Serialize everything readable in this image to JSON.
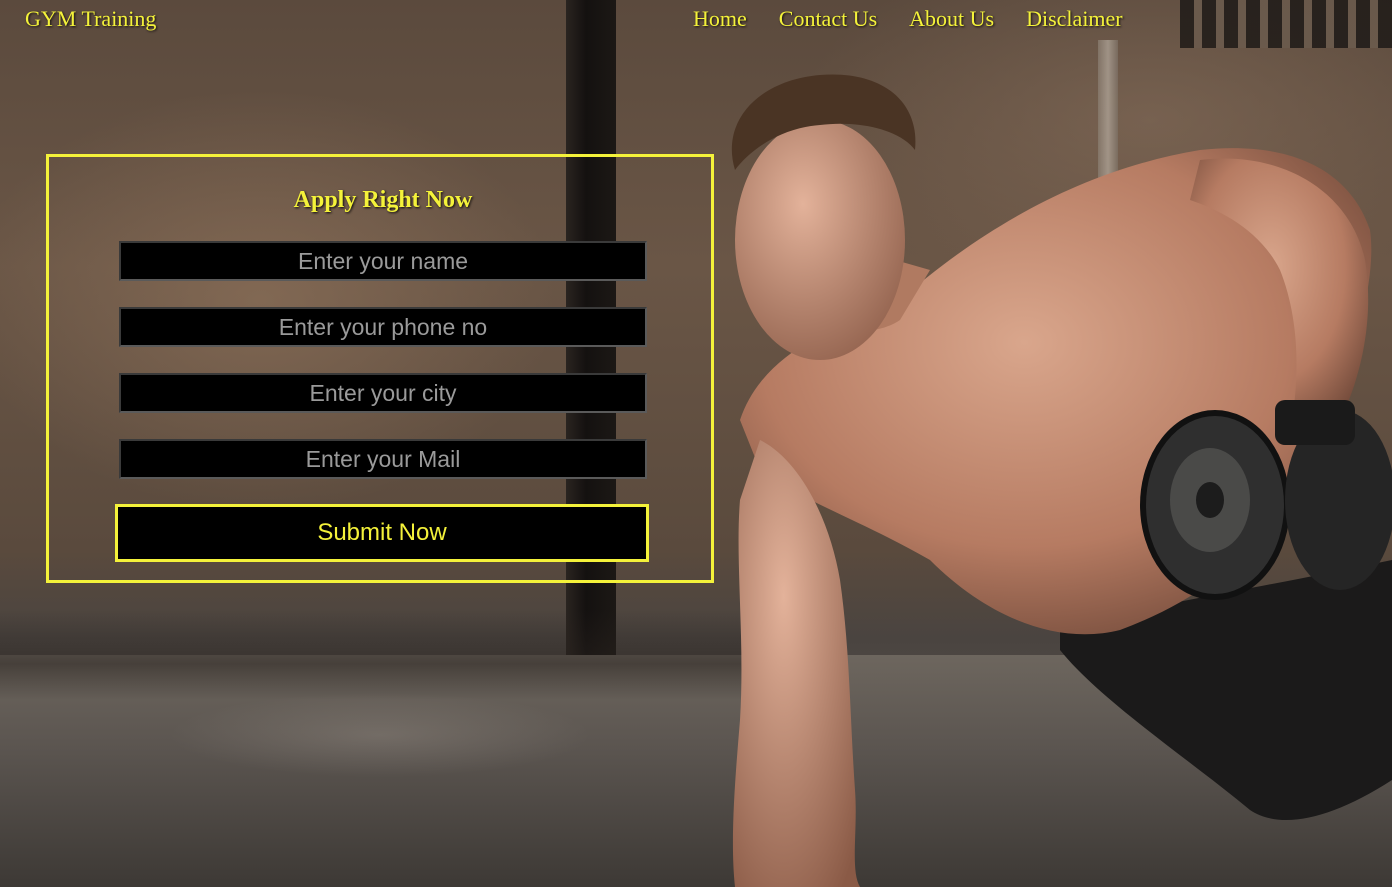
{
  "header": {
    "brand": "GYM Training",
    "nav": [
      "Home",
      "Contact Us",
      "About Us",
      "Disclaimer"
    ]
  },
  "form": {
    "title": "Apply Right Now",
    "name_placeholder": "Enter your name",
    "phone_placeholder": "Enter your phone no",
    "city_placeholder": "Enter your city",
    "mail_placeholder": "Enter your Mail",
    "submit_label": "Submit Now"
  },
  "theme": {
    "accent": "#f4f23a",
    "field_bg": "#000000"
  },
  "background": {
    "subject": "shirtless man doing one-arm dumbbell row plank in industrial gym"
  }
}
